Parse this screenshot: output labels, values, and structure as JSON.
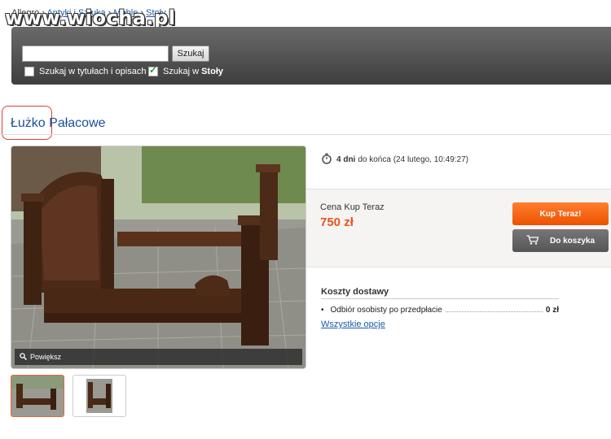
{
  "watermark": "www.wiocha.pl",
  "breadcrumb": {
    "items": [
      "Allegro",
      "Antyki i Sztuka",
      "Meble",
      "Stoły"
    ],
    "separator": "›"
  },
  "search": {
    "value": "",
    "button_label": "Szukaj",
    "option_titles_label": "Szukaj w tytułach i opisach",
    "option_titles_checked": false,
    "option_category_prefix": "Szukaj w",
    "option_category_name": "Stoły",
    "option_category_checked": true
  },
  "item": {
    "title_first": "Łużko",
    "title_rest": "Pałacowe"
  },
  "gallery": {
    "zoom_label": "Powiększ",
    "thumbnails": 2,
    "active_thumbnail": 0
  },
  "timer": {
    "days": "4 dni",
    "suffix": "do końca (24 lutego, 10:49:27)"
  },
  "buy": {
    "price_label": "Cena Kup Teraz",
    "price": "750 zł",
    "buy_now_label": "Kup Teraz!",
    "add_to_cart_label": "Do koszyka"
  },
  "shipping": {
    "title": "Koszty dostawy",
    "options": [
      {
        "name": "Odbiór osobisty po przedpłacie",
        "price": "0 zł"
      }
    ],
    "all_options_link": "Wszystkie opcje"
  },
  "colors": {
    "accent_orange": "#ec5200",
    "link_blue": "#1a5aa8",
    "title_blue": "#1a4f9c",
    "highlight_red": "#e23b3b"
  }
}
